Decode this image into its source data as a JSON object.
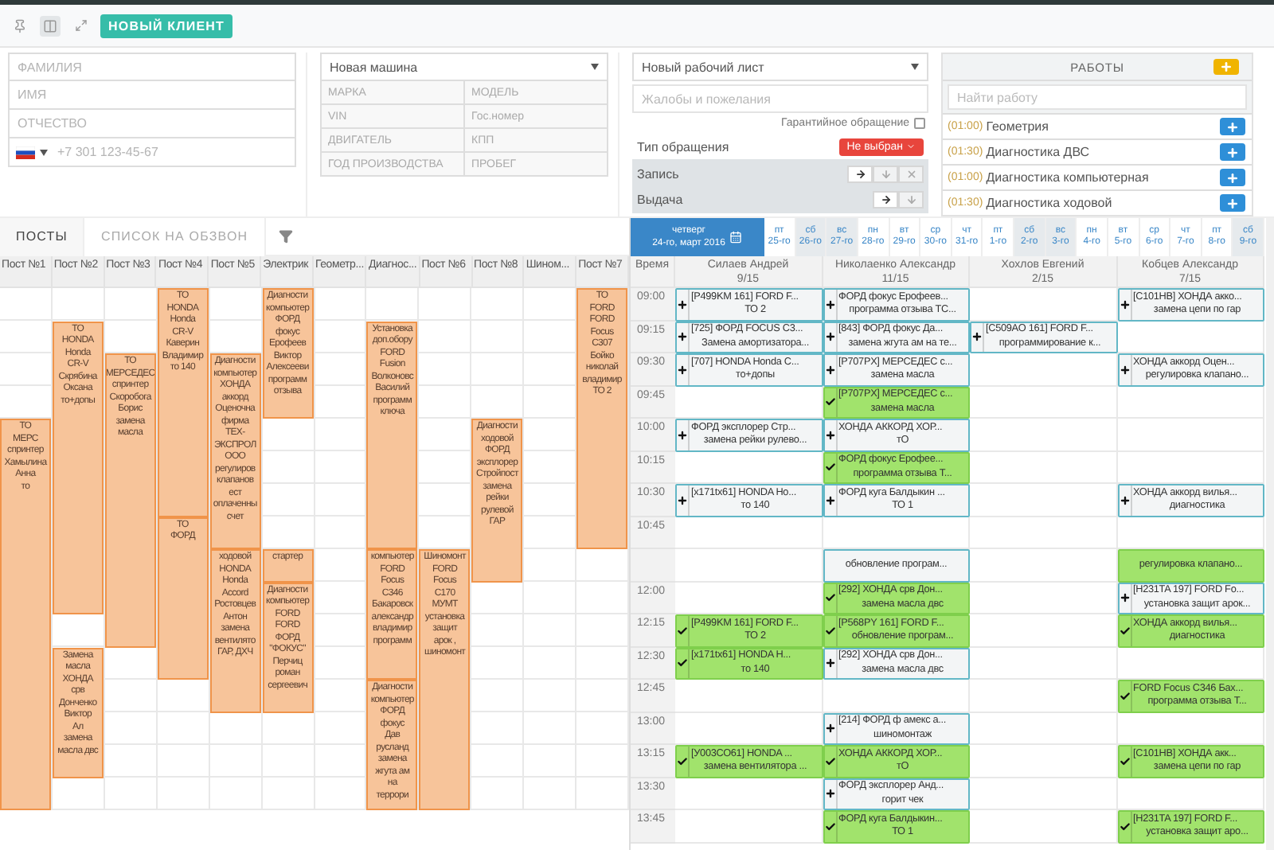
{
  "toolbar": {
    "new_client_button": "НОВЫЙ КЛИЕНТ"
  },
  "client": {
    "fields": [
      {
        "placeholder": "ФАМИЛИЯ"
      },
      {
        "placeholder": "ИМЯ"
      },
      {
        "placeholder": "ОТЧЕСТВО"
      }
    ],
    "phone": {
      "placeholder": "+7 301 123-45-67"
    }
  },
  "car": {
    "select": "Новая машина",
    "fields": [
      {
        "placeholder": "МАРКА"
      },
      {
        "placeholder": "МОДЕЛЬ"
      },
      {
        "placeholder": "VIN"
      },
      {
        "placeholder": "Гос.номер"
      },
      {
        "placeholder": "ДВИГАТЕЛЬ"
      },
      {
        "placeholder": "КПП"
      },
      {
        "placeholder": "ГОД ПРОИЗВОДСТВА"
      },
      {
        "placeholder": "ПРОБЕГ"
      }
    ]
  },
  "worksheet": {
    "select": "Новый рабочий лист",
    "complaints": {
      "placeholder": "Жалобы и пожелания"
    },
    "warranty": {
      "label": "Гарантийное обращение",
      "checked": false
    },
    "request_type": {
      "label": "Тип обращения",
      "value": "Не выбран"
    },
    "actions": [
      {
        "label": "Запись",
        "buttons": [
          {
            "kind": "forward"
          },
          {
            "kind": "down"
          },
          {
            "kind": "remove"
          }
        ]
      },
      {
        "label": "Выдача",
        "buttons": [
          {
            "kind": "forward"
          },
          {
            "kind": "down"
          }
        ]
      }
    ]
  },
  "jobs": {
    "title": "РАБОТЫ",
    "search": {
      "placeholder": "Найти работу"
    },
    "items": [
      {
        "duration": "(01:00)",
        "name": "Геометрия"
      },
      {
        "duration": "(01:30)",
        "name": "Диагностика ДВС"
      },
      {
        "duration": "(01:00)",
        "name": "Диагностика компьютерная"
      },
      {
        "duration": "(01:30)",
        "name": "Диагностика ходовой"
      }
    ]
  },
  "tabs": [
    {
      "label": "ПОСТЫ",
      "selected": true
    },
    {
      "label": "СПИСОК НА ОБЗВОН",
      "selected": false
    }
  ],
  "posts": [
    {
      "name": "Пост №1",
      "slots": [
        {
          "kind": "empty"
        },
        {
          "kind": "empty"
        },
        {
          "kind": "empty"
        },
        {
          "kind": "empty"
        },
        {
          "kind": "booking",
          "lines": [
            "ТО",
            "МЕРС",
            "спринтер",
            "Хамылина",
            "Анна",
            "то"
          ]
        },
        {
          "kind": "continued"
        },
        {
          "kind": "continued"
        },
        {
          "kind": "continued"
        },
        {
          "kind": "continued"
        },
        {
          "kind": "continued"
        },
        {
          "kind": "continued"
        },
        {
          "kind": "continued"
        },
        {
          "kind": "continued"
        },
        {
          "kind": "continued"
        },
        {
          "kind": "continued"
        },
        {
          "kind": "continued"
        }
      ]
    },
    {
      "name": "Пост №2",
      "slots": [
        {
          "kind": "empty"
        },
        {
          "kind": "booking",
          "lines": [
            "ТО",
            "HONDA",
            "Honda",
            "CR-V",
            "Скрябина",
            "Оксана",
            "то+допы"
          ]
        },
        {
          "kind": "continued"
        },
        {
          "kind": "continued"
        },
        {
          "kind": "continued"
        },
        {
          "kind": "continued"
        },
        {
          "kind": "continued"
        },
        {
          "kind": "continued"
        },
        {
          "kind": "continued"
        },
        {
          "kind": "continued"
        },
        {
          "kind": "empty"
        },
        {
          "kind": "booking",
          "lines": [
            "Замена",
            "масла",
            "ХОНДА",
            "срв",
            "Донченко",
            "Виктор",
            "Ал",
            "замена",
            "масла двс"
          ]
        },
        {
          "kind": "continued"
        },
        {
          "kind": "continued"
        },
        {
          "kind": "continued"
        },
        {
          "kind": "empty"
        }
      ]
    },
    {
      "name": "Пост №3",
      "slots": [
        {
          "kind": "empty"
        },
        {
          "kind": "empty"
        },
        {
          "kind": "booking",
          "lines": [
            "ТО",
            "МЕРСЕДЕС",
            "спринтер",
            "Скоробога",
            "Борис",
            "замена",
            "масла"
          ]
        },
        {
          "kind": "continued"
        },
        {
          "kind": "continued"
        },
        {
          "kind": "continued"
        },
        {
          "kind": "continued"
        },
        {
          "kind": "continued"
        },
        {
          "kind": "continued"
        },
        {
          "kind": "continued"
        },
        {
          "kind": "continued"
        },
        {
          "kind": "empty"
        },
        {
          "kind": "empty"
        },
        {
          "kind": "empty"
        },
        {
          "kind": "empty"
        },
        {
          "kind": "empty"
        }
      ]
    },
    {
      "name": "Пост №4",
      "slots": [
        {
          "kind": "booking",
          "lines": [
            "ТО",
            "HONDA",
            "Honda",
            "CR-V",
            "Каверин",
            "Владимир",
            "то 140"
          ]
        },
        {
          "kind": "continued"
        },
        {
          "kind": "continued"
        },
        {
          "kind": "continued"
        },
        {
          "kind": "continued"
        },
        {
          "kind": "continued"
        },
        {
          "kind": "continued"
        },
        {
          "kind": "booking",
          "lines": [
            "ТО",
            "ФОРД"
          ]
        },
        {
          "kind": "continued"
        },
        {
          "kind": "continued"
        },
        {
          "kind": "continued"
        },
        {
          "kind": "continued"
        },
        {
          "kind": "empty"
        },
        {
          "kind": "empty"
        },
        {
          "kind": "empty"
        },
        {
          "kind": "empty"
        }
      ]
    },
    {
      "name": "Пост №5",
      "slots": [
        {
          "kind": "empty"
        },
        {
          "kind": "empty"
        },
        {
          "kind": "booking",
          "lines": [
            "Диагности",
            "компьютер",
            "ХОНДА",
            "аккорд",
            "Оценочна",
            "фирма",
            "ТЕХ-",
            "ЭКСПРОЛ",
            "ООО",
            "регулиров",
            "клапанов",
            "ест",
            "оплаченны",
            "счет"
          ]
        },
        {
          "kind": "continued"
        },
        {
          "kind": "continued"
        },
        {
          "kind": "continued"
        },
        {
          "kind": "continued"
        },
        {
          "kind": "continued"
        },
        {
          "kind": "booking",
          "lines": [
            "ходовой",
            "HONDA",
            "Honda",
            "Accord",
            "Ростовцев",
            "Антон",
            "замена",
            "вентилято",
            "ГАР, ДХЧ"
          ]
        },
        {
          "kind": "continued"
        },
        {
          "kind": "continued"
        },
        {
          "kind": "continued"
        },
        {
          "kind": "continued"
        },
        {
          "kind": "empty"
        },
        {
          "kind": "empty"
        },
        {
          "kind": "empty"
        }
      ]
    },
    {
      "name": "Электрик",
      "slots": [
        {
          "kind": "booking",
          "lines": [
            "Диагности",
            "компьютер",
            "ФОРД",
            "фокус",
            "Ерофеев",
            "Виктор",
            "Алексееви",
            "программ",
            "отзыва"
          ]
        },
        {
          "kind": "continued"
        },
        {
          "kind": "continued"
        },
        {
          "kind": "continued"
        },
        {
          "kind": "empty"
        },
        {
          "kind": "empty"
        },
        {
          "kind": "empty"
        },
        {
          "kind": "empty"
        },
        {
          "kind": "booking",
          "lines": [
            "стартер"
          ]
        },
        {
          "kind": "booking",
          "lines": [
            "Диагности",
            "компьютер",
            "FORD",
            "FORD",
            "ФОРД",
            "\"ФОКУС\"",
            "Перчиц",
            "роман",
            "сергеевич"
          ]
        },
        {
          "kind": "continued"
        },
        {
          "kind": "continued"
        },
        {
          "kind": "continued"
        },
        {
          "kind": "empty"
        },
        {
          "kind": "empty"
        },
        {
          "kind": "empty"
        }
      ]
    },
    {
      "name": "Геометр...",
      "slots": [
        {
          "kind": "empty"
        },
        {
          "kind": "empty"
        },
        {
          "kind": "empty"
        },
        {
          "kind": "empty"
        },
        {
          "kind": "empty"
        },
        {
          "kind": "empty"
        },
        {
          "kind": "empty"
        },
        {
          "kind": "empty"
        },
        {
          "kind": "empty"
        },
        {
          "kind": "empty"
        },
        {
          "kind": "empty"
        },
        {
          "kind": "empty"
        },
        {
          "kind": "empty"
        },
        {
          "kind": "empty"
        },
        {
          "kind": "empty"
        },
        {
          "kind": "empty"
        }
      ]
    },
    {
      "name": "Диагнос...",
      "slots": [
        {
          "kind": "empty"
        },
        {
          "kind": "booking",
          "lines": [
            "Установка",
            "доп.обору",
            "FORD",
            "Fusion",
            "Волконовс",
            "Василий",
            "программ",
            "ключа"
          ]
        },
        {
          "kind": "continued"
        },
        {
          "kind": "continued"
        },
        {
          "kind": "continued"
        },
        {
          "kind": "continued"
        },
        {
          "kind": "continued"
        },
        {
          "kind": "continued"
        },
        {
          "kind": "booking",
          "lines": [
            "компьютер",
            "FORD",
            "Focus",
            "C346",
            "Бакаровск",
            "александр",
            "владимир",
            "программ"
          ]
        },
        {
          "kind": "continued"
        },
        {
          "kind": "continued"
        },
        {
          "kind": "continued"
        },
        {
          "kind": "booking",
          "lines": [
            "Диагности",
            "компьютер",
            "ФОРД",
            "фокус",
            "Дав",
            "русланд",
            "замена",
            "жгута ам",
            "на",
            "террори"
          ]
        },
        {
          "kind": "continued"
        },
        {
          "kind": "continued"
        },
        {
          "kind": "continued"
        }
      ]
    },
    {
      "name": "Пост №6",
      "slots": [
        {
          "kind": "empty"
        },
        {
          "kind": "empty"
        },
        {
          "kind": "empty"
        },
        {
          "kind": "empty"
        },
        {
          "kind": "empty"
        },
        {
          "kind": "empty"
        },
        {
          "kind": "empty"
        },
        {
          "kind": "empty"
        },
        {
          "kind": "booking",
          "lines": [
            "Шиномонт",
            "FORD",
            "Focus",
            "C170",
            "МУМТ",
            "установка",
            "защит",
            "арок ,",
            "шиномонт"
          ]
        },
        {
          "kind": "continued"
        },
        {
          "kind": "continued"
        },
        {
          "kind": "continued"
        },
        {
          "kind": "continued"
        },
        {
          "kind": "continued"
        },
        {
          "kind": "continued"
        },
        {
          "kind": "continued"
        }
      ]
    },
    {
      "name": "Пост №8",
      "slots": [
        {
          "kind": "empty"
        },
        {
          "kind": "empty"
        },
        {
          "kind": "empty"
        },
        {
          "kind": "empty"
        },
        {
          "kind": "booking",
          "lines": [
            "Диагности",
            "ходовой",
            "ФОРД",
            "эксплорер",
            "Стройпост",
            "замена",
            "рейки",
            "рулевой",
            "ГАР"
          ]
        },
        {
          "kind": "continued"
        },
        {
          "kind": "continued"
        },
        {
          "kind": "continued"
        },
        {
          "kind": "continued"
        },
        {
          "kind": "empty"
        },
        {
          "kind": "empty"
        },
        {
          "kind": "empty"
        },
        {
          "kind": "empty"
        },
        {
          "kind": "empty"
        },
        {
          "kind": "empty"
        },
        {
          "kind": "empty"
        }
      ]
    },
    {
      "name": "Шином...",
      "slots": [
        {
          "kind": "empty"
        },
        {
          "kind": "empty"
        },
        {
          "kind": "empty"
        },
        {
          "kind": "empty"
        },
        {
          "kind": "empty"
        },
        {
          "kind": "empty"
        },
        {
          "kind": "empty"
        },
        {
          "kind": "empty"
        },
        {
          "kind": "empty"
        },
        {
          "kind": "empty"
        },
        {
          "kind": "empty"
        },
        {
          "kind": "empty"
        },
        {
          "kind": "empty"
        },
        {
          "kind": "empty"
        },
        {
          "kind": "empty"
        },
        {
          "kind": "empty"
        }
      ]
    },
    {
      "name": "Пост №7",
      "slots": [
        {
          "kind": "booking",
          "lines": [
            "ТО",
            "FORD",
            "FORD",
            "Focus",
            "C307",
            "Бойко",
            "николай",
            "владимир",
            "ТО 2"
          ]
        },
        {
          "kind": "continued"
        },
        {
          "kind": "continued"
        },
        {
          "kind": "continued"
        },
        {
          "kind": "continued"
        },
        {
          "kind": "continued"
        },
        {
          "kind": "continued"
        },
        {
          "kind": "continued"
        },
        {
          "kind": "empty"
        },
        {
          "kind": "empty"
        },
        {
          "kind": "empty"
        },
        {
          "kind": "empty"
        },
        {
          "kind": "empty"
        },
        {
          "kind": "empty"
        },
        {
          "kind": "empty"
        },
        {
          "kind": "empty"
        }
      ]
    }
  ],
  "calendar": {
    "current": {
      "weekday": "четверг",
      "date": "24-го, март 2016"
    },
    "days": [
      {
        "weekday": "пт",
        "date": "25-го",
        "weekend": false
      },
      {
        "weekday": "сб",
        "date": "26-го",
        "weekend": true
      },
      {
        "weekday": "вс",
        "date": "27-го",
        "weekend": true
      },
      {
        "weekday": "пн",
        "date": "28-го",
        "weekend": false
      },
      {
        "weekday": "вт",
        "date": "29-го",
        "weekend": false
      },
      {
        "weekday": "ср",
        "date": "30-го",
        "weekend": false
      },
      {
        "weekday": "чт",
        "date": "31-го",
        "weekend": false
      },
      {
        "weekday": "пт",
        "date": "1-го",
        "weekend": false
      },
      {
        "weekday": "сб",
        "date": "2-го",
        "weekend": true
      },
      {
        "weekday": "вс",
        "date": "3-го",
        "weekend": true
      },
      {
        "weekday": "пн",
        "date": "4-го",
        "weekend": false
      },
      {
        "weekday": "вт",
        "date": "5-го",
        "weekend": false
      },
      {
        "weekday": "ср",
        "date": "6-го",
        "weekend": false
      },
      {
        "weekday": "чт",
        "date": "7-го",
        "weekend": false
      },
      {
        "weekday": "пт",
        "date": "8-го",
        "weekend": false
      },
      {
        "weekday": "сб",
        "date": "9-го",
        "weekend": true
      }
    ]
  },
  "schedule": {
    "time_heading": "Время",
    "staff": [
      {
        "name": "Силаев Андрей",
        "load": "9/15"
      },
      {
        "name": "Николаенко Александр",
        "load": "11/15"
      },
      {
        "name": "Хохлов Евгений",
        "load": "2/15"
      },
      {
        "name": "Кобцев Александр",
        "load": "7/15"
      }
    ],
    "rows": [
      {
        "kind": "slot",
        "time": "09:00",
        "cells": [
          {
            "kind": "open",
            "lines": [
              "[P499KM 161] FORD F...",
              "ТО 2"
            ]
          },
          {
            "kind": "open",
            "lines": [
              "ФОРД фокус Ерофеев...",
              "программа отзыва ТС..."
            ]
          },
          {
            "kind": "none"
          },
          {
            "kind": "open",
            "lines": [
              "[C101HB] ХОНДА акко...",
              "замена цепи по гар"
            ]
          }
        ]
      },
      {
        "kind": "slot",
        "time": "09:15",
        "cells": [
          {
            "kind": "open",
            "lines": [
              "[725] ФОРД FOCUS C3...",
              "Замена амортизатора..."
            ]
          },
          {
            "kind": "open",
            "lines": [
              "[843] ФОРД фокус Да...",
              "замена жгута ам на те..."
            ]
          },
          {
            "kind": "open",
            "lines": [
              "[C509AO 161] FORD F...",
              "программирование к..."
            ]
          },
          {
            "kind": "none"
          }
        ]
      },
      {
        "kind": "slot",
        "time": "09:30",
        "cells": [
          {
            "kind": "open",
            "lines": [
              "[707] HONDA Honda C...",
              "то+допы"
            ]
          },
          {
            "kind": "open",
            "lines": [
              "[P707PX] МЕРСЕДЕС с...",
              "замена масла"
            ]
          },
          {
            "kind": "none"
          },
          {
            "kind": "open",
            "lines": [
              "ХОНДА аккорд Оцен...",
              "регулировка клапано..."
            ]
          }
        ]
      },
      {
        "kind": "slot",
        "time": "09:45",
        "cells": [
          {
            "kind": "none"
          },
          {
            "kind": "done",
            "lines": [
              "[P707PX] МЕРСЕДЕС с...",
              "замена масла"
            ]
          },
          {
            "kind": "none"
          },
          {
            "kind": "none"
          }
        ]
      },
      {
        "kind": "slot",
        "time": "10:00",
        "cells": [
          {
            "kind": "open",
            "lines": [
              "ФОРД эксплорер Стр...",
              "замена рейки рулево..."
            ]
          },
          {
            "kind": "open",
            "lines": [
              "ХОНДА АККОРД ХОР...",
              "тО"
            ]
          },
          {
            "kind": "none"
          },
          {
            "kind": "none"
          }
        ]
      },
      {
        "kind": "slot",
        "time": "10:15",
        "cells": [
          {
            "kind": "none"
          },
          {
            "kind": "done",
            "lines": [
              "ФОРД фокус Ерофее...",
              "программа отзыва Т..."
            ]
          },
          {
            "kind": "none"
          },
          {
            "kind": "none"
          }
        ]
      },
      {
        "kind": "slot",
        "time": "10:30",
        "cells": [
          {
            "kind": "open",
            "lines": [
              "[x171tx61] HONDA Ho...",
              "то 140"
            ]
          },
          {
            "kind": "open",
            "lines": [
              "ФОРД куга Балдыкин ...",
              "ТО 1"
            ]
          },
          {
            "kind": "none"
          },
          {
            "kind": "open",
            "lines": [
              "ХОНДА аккорд вилья...",
              "диагностика"
            ]
          }
        ]
      },
      {
        "kind": "slot",
        "time": "10:45",
        "cells": [
          {
            "kind": "none"
          },
          {
            "kind": "none"
          },
          {
            "kind": "none"
          },
          {
            "kind": "none"
          }
        ]
      },
      {
        "kind": "cut",
        "cells": [
          {
            "kind": "none"
          },
          {
            "kind": "open",
            "lines": [
              "обновление програм..."
            ]
          },
          {
            "kind": "none"
          },
          {
            "kind": "done",
            "lines": [
              "регулировка клапано..."
            ]
          }
        ]
      },
      {
        "kind": "slot",
        "time": "12:00",
        "cells": [
          {
            "kind": "none"
          },
          {
            "kind": "done",
            "lines": [
              "[292] ХОНДА срв Дон...",
              "замена масла двс"
            ]
          },
          {
            "kind": "none"
          },
          {
            "kind": "open",
            "lines": [
              "[H231TA 197] FORD Fo...",
              "установка защит арок..."
            ]
          }
        ]
      },
      {
        "kind": "slot",
        "time": "12:15",
        "cells": [
          {
            "kind": "done",
            "lines": [
              "[P499KM 161] FORD F...",
              "ТО 2"
            ]
          },
          {
            "kind": "done",
            "lines": [
              "[P568PY 161] FORD F...",
              "обновление програм..."
            ]
          },
          {
            "kind": "none"
          },
          {
            "kind": "done",
            "lines": [
              "ХОНДА аккорд вилья...",
              "диагностика"
            ]
          }
        ]
      },
      {
        "kind": "slot",
        "time": "12:30",
        "cells": [
          {
            "kind": "done",
            "lines": [
              "[x171tx61] HONDA H...",
              "то 140"
            ]
          },
          {
            "kind": "open",
            "lines": [
              "[292] ХОНДА срв Дон...",
              "замена масла двс"
            ]
          },
          {
            "kind": "none"
          },
          {
            "kind": "none"
          }
        ]
      },
      {
        "kind": "slot",
        "time": "12:45",
        "cells": [
          {
            "kind": "none"
          },
          {
            "kind": "none"
          },
          {
            "kind": "none"
          },
          {
            "kind": "done",
            "lines": [
              "FORD Focus C346 Бах...",
              "программа отзыва Т..."
            ]
          }
        ]
      },
      {
        "kind": "slot",
        "time": "13:00",
        "cells": [
          {
            "kind": "none"
          },
          {
            "kind": "open",
            "lines": [
              "[214] ФОРД ф амекс а...",
              "шиномонтаж"
            ]
          },
          {
            "kind": "none"
          },
          {
            "kind": "none"
          }
        ]
      },
      {
        "kind": "slot",
        "time": "13:15",
        "cells": [
          {
            "kind": "done",
            "lines": [
              "[У003СО61] HONDA ...",
              "замена вентилятора ..."
            ]
          },
          {
            "kind": "done",
            "lines": [
              "ХОНДА АККОРД ХОР...",
              "тО"
            ]
          },
          {
            "kind": "none"
          },
          {
            "kind": "done",
            "lines": [
              "[C101HB] ХОНДА акк...",
              "замена цепи по гар"
            ]
          }
        ]
      },
      {
        "kind": "slot",
        "time": "13:30",
        "cells": [
          {
            "kind": "none"
          },
          {
            "kind": "open",
            "lines": [
              "ФОРД эксплорер Анд...",
              "горит чек"
            ]
          },
          {
            "kind": "none"
          },
          {
            "kind": "none"
          }
        ]
      },
      {
        "kind": "slot",
        "time": "13:45",
        "cells": [
          {
            "kind": "none"
          },
          {
            "kind": "done",
            "lines": [
              "ФОРД куга Балдыкин...",
              "ТО 1"
            ]
          },
          {
            "kind": "none"
          },
          {
            "kind": "done",
            "lines": [
              "[H231TA 197] FORD F...",
              "установка защит аро..."
            ]
          }
        ]
      }
    ]
  }
}
